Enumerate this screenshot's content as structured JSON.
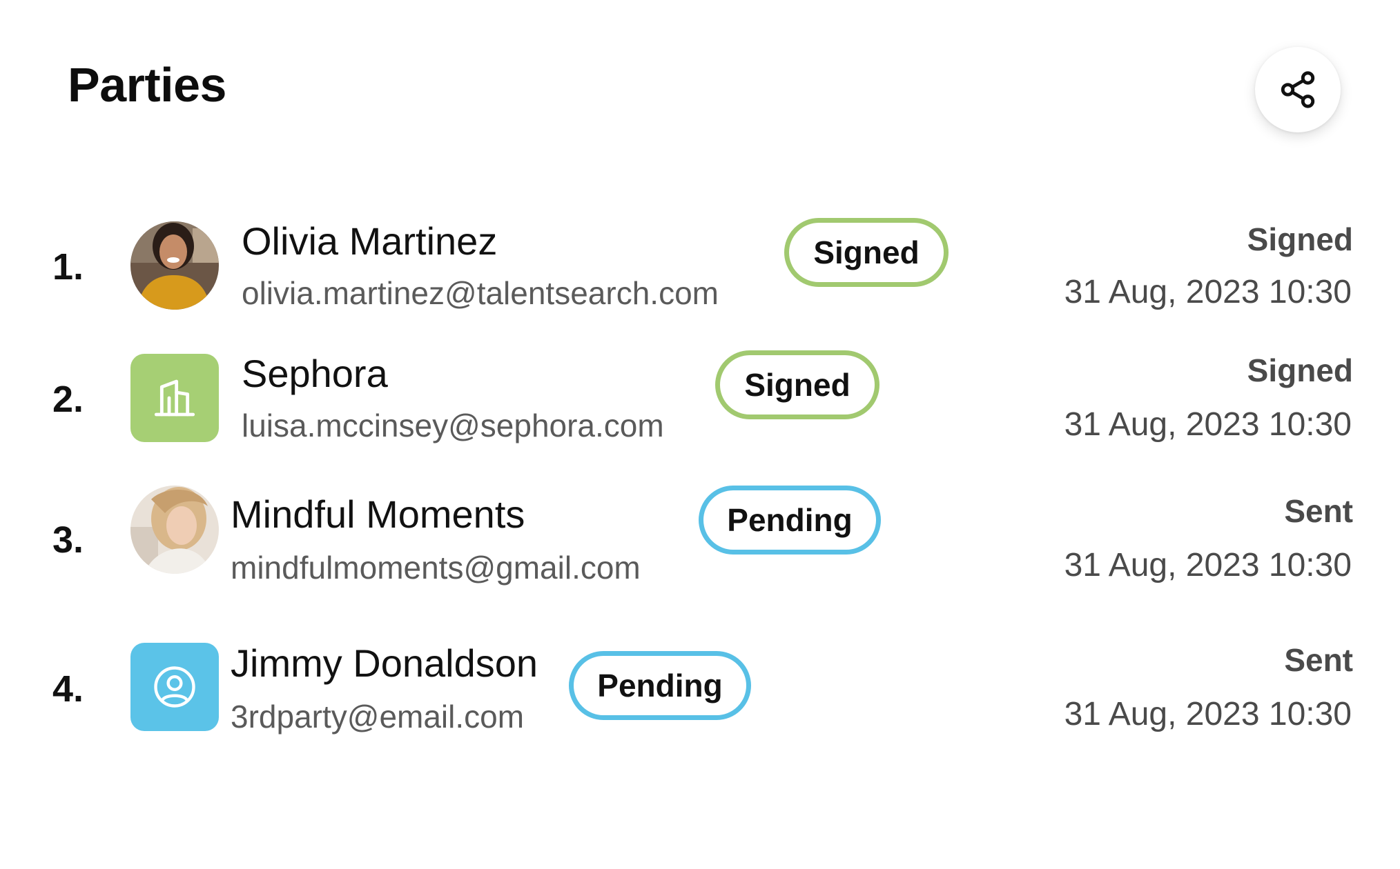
{
  "header": {
    "title": "Parties",
    "share_icon": "share-icon"
  },
  "colors": {
    "signed_border": "#a1c96f",
    "pending_border": "#58c0e6",
    "company_avatar_bg": "#a6cf74",
    "user_avatar_bg": "#5bc3e8"
  },
  "parties": [
    {
      "index": "1.",
      "name": "Olivia Martinez",
      "email": "olivia.martinez@talentsearch.com",
      "badge": "Signed",
      "status": "Signed",
      "date": "31 Aug, 2023 10:30",
      "avatar": "photo"
    },
    {
      "index": "2.",
      "name": "Sephora",
      "email": "luisa.mccinsey@sephora.com",
      "badge": "Signed",
      "status": "Signed",
      "date": "31 Aug, 2023 10:30",
      "avatar": "building-icon"
    },
    {
      "index": "3.",
      "name": "Mindful Moments",
      "email": "mindfulmoments@gmail.com",
      "badge": "Pending",
      "status": "Sent",
      "date": "31 Aug, 2023 10:30",
      "avatar": "photo"
    },
    {
      "index": "4.",
      "name": "Jimmy Donaldson",
      "email": "3rdparty@email.com",
      "badge": "Pending",
      "status": "Sent",
      "date": "31 Aug, 2023 10:30",
      "avatar": "user-circle-icon"
    }
  ]
}
